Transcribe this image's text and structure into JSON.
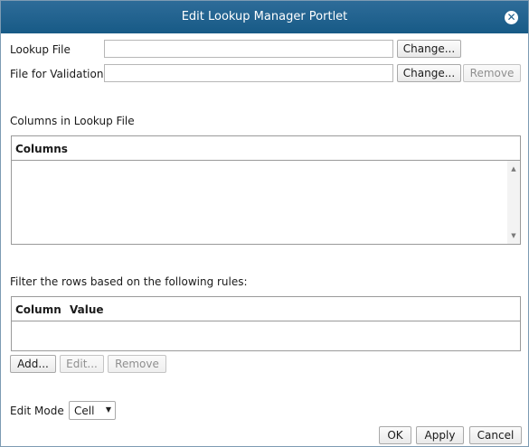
{
  "dialog": {
    "title": "Edit Lookup Manager Portlet",
    "close_symbol": "✕"
  },
  "lookup_file": {
    "label": "Lookup File",
    "value": "",
    "change_label": "Change..."
  },
  "validation_file": {
    "label": "File for Validation",
    "value": "",
    "change_label": "Change...",
    "remove_label": "Remove"
  },
  "columns_section": {
    "label": "Columns in Lookup File",
    "header": "Columns"
  },
  "filter_section": {
    "label": "Filter the rows based on the following rules:",
    "column_header": "Column",
    "value_header": "Value",
    "add_label": "Add...",
    "edit_label": "Edit...",
    "remove_label": "Remove"
  },
  "edit_mode": {
    "label": "Edit Mode",
    "selected": "Cell"
  },
  "footer": {
    "ok_label": "OK",
    "apply_label": "Apply",
    "cancel_label": "Cancel"
  },
  "colors": {
    "titlebar": "#1f5f8b",
    "border": "#9a9a9a"
  }
}
